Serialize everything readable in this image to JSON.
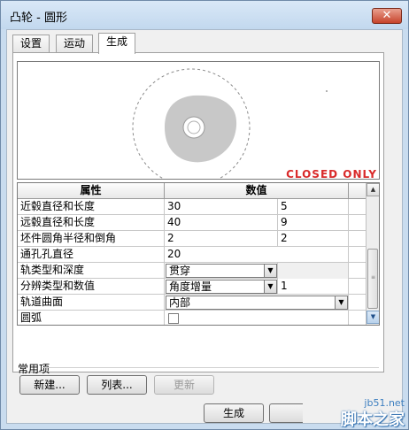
{
  "window": {
    "title": "凸轮 - 圆形",
    "close_glyph": "✕"
  },
  "tabs": [
    {
      "label": "设置",
      "active": false
    },
    {
      "label": "运动",
      "active": false
    },
    {
      "label": "生成",
      "active": true
    }
  ],
  "preview": {
    "overlay_text": "CLOSED ONLY"
  },
  "grid": {
    "headers": [
      "属性",
      "数值"
    ],
    "rows": [
      {
        "label": "近毂直径和长度",
        "v1": "30",
        "v2": "5"
      },
      {
        "label": "远毂直径和长度",
        "v1": "40",
        "v2": "9"
      },
      {
        "label": "坯件圆角半径和倒角",
        "v1": "2",
        "v2": "2"
      },
      {
        "label": "通孔孔直径",
        "v1": "20",
        "v2": ""
      },
      {
        "label": "轨类型和深度",
        "v1": "贯穿",
        "v2": ""
      },
      {
        "label": "分辨类型和数值",
        "v1": "角度增量",
        "v2": "1"
      },
      {
        "label": "轨道曲面",
        "v1": "内部",
        "v2": ""
      },
      {
        "label": "圆弧",
        "v1": "",
        "v2": ""
      }
    ]
  },
  "common": {
    "label": "常用项",
    "new_label": "新建...",
    "list_label": "列表...",
    "update_label": "更新"
  },
  "footer": {
    "generate_label": "生成"
  },
  "watermark": {
    "url": "jb51.net",
    "brand": "脚本之家"
  },
  "colors": {
    "overlay": "#d92a2a",
    "cam_fill": "#c8c8c8"
  }
}
